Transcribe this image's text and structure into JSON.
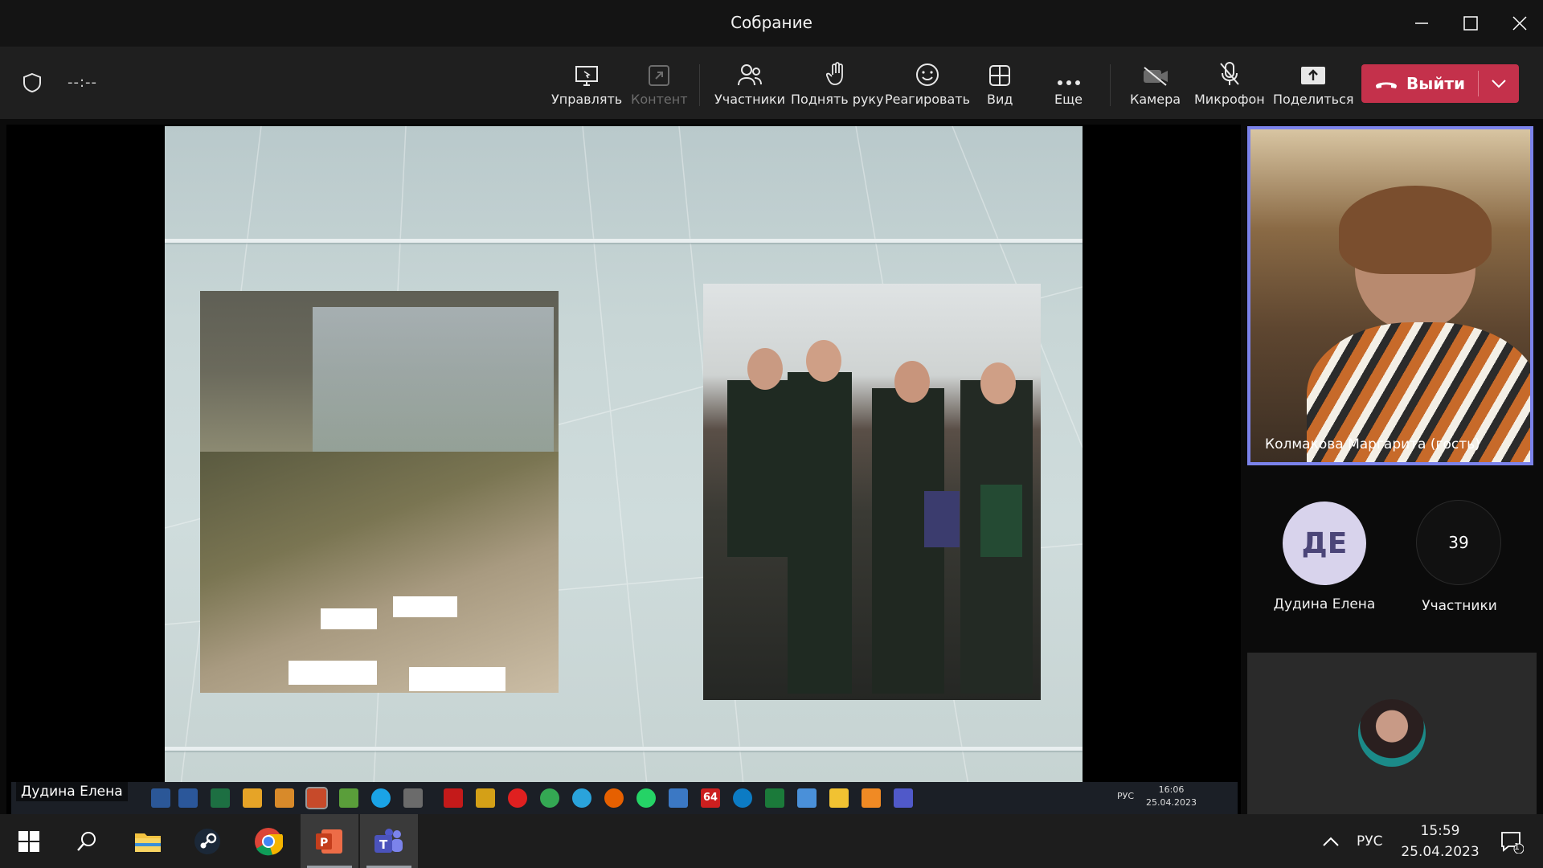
{
  "window": {
    "title": "Собрание"
  },
  "toolbar": {
    "timer": "--:--",
    "buttons": [
      {
        "label": "Управлять"
      },
      {
        "label": "Контент"
      },
      {
        "label": "Участники"
      },
      {
        "label": "Поднять руку"
      },
      {
        "label": "Реагировать"
      },
      {
        "label": "Вид"
      },
      {
        "label": "Еще"
      },
      {
        "label": "Камера"
      },
      {
        "label": "Микрофон"
      },
      {
        "label": "Поделиться"
      }
    ],
    "leave_label": "Выйти"
  },
  "stage": {
    "presenter_label": "Дудина Елена",
    "inner_taskbar": {
      "badge": "64",
      "lang": "РУС",
      "time": "16:06",
      "date": "25.04.2023"
    }
  },
  "participants": {
    "self_name": "Колмакова Маргарита (гость)",
    "tiles": [
      {
        "initials": "ДЕ",
        "name": "Дудина Елена"
      },
      {
        "count": "39",
        "name": "Участники"
      }
    ]
  },
  "taskbar": {
    "lang": "РУС",
    "time": "15:59",
    "date": "25.04.2023",
    "notifications": "1"
  },
  "colors": {
    "accent": "#7b83eb",
    "leave": "#c4314b",
    "avatar_bg": "#d8d3ec",
    "avatar_fg": "#4b4578"
  }
}
